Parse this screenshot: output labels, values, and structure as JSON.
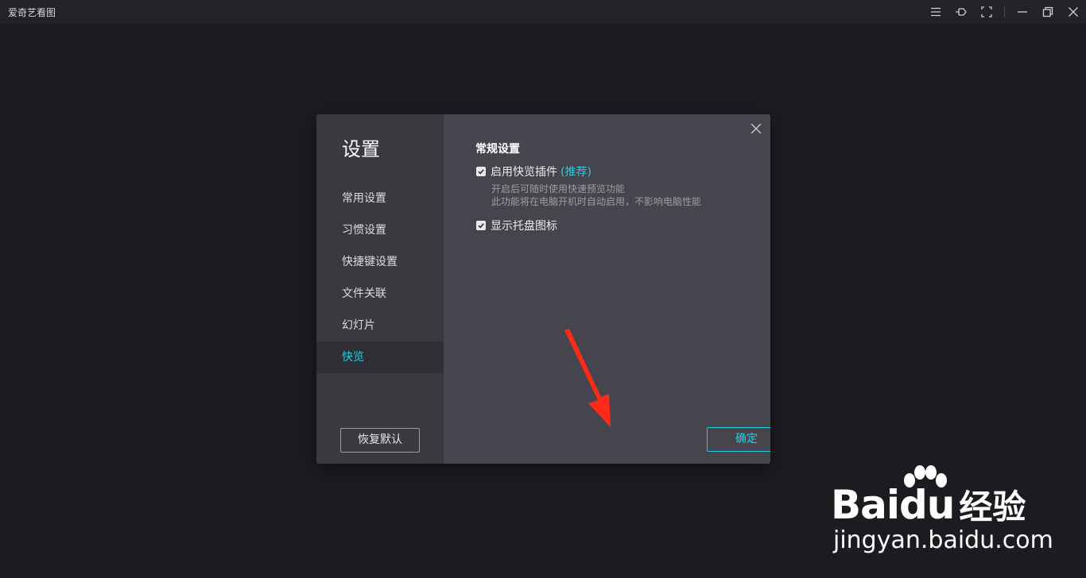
{
  "window": {
    "title": "爱奇艺看图",
    "icons": [
      "menu-icon",
      "pin-icon",
      "fullscreen-icon",
      "minimize-icon",
      "restore-icon",
      "close-icon"
    ]
  },
  "dialog": {
    "title": "设置",
    "nav": [
      {
        "label": "常用设置",
        "active": false
      },
      {
        "label": "习惯设置",
        "active": false
      },
      {
        "label": "快捷键设置",
        "active": false
      },
      {
        "label": "文件关联",
        "active": false
      },
      {
        "label": "幻灯片",
        "active": false
      },
      {
        "label": "快览",
        "active": true
      }
    ],
    "reset_label": "恢复默认",
    "section_title": "常规设置",
    "option1": {
      "label": "启用快览插件",
      "recommend": "(推荐)",
      "checked": true,
      "desc1": "开启后可随时使用快速预览功能",
      "desc2": "此功能将在电脑开机时自动启用，不影响电脑性能"
    },
    "option2": {
      "label": "显示托盘图标",
      "checked": true
    },
    "ok_label": "确定",
    "close_label": "关闭"
  },
  "colors": {
    "accent": "#1fd0e6",
    "annotation_arrow": "#ff2a1a",
    "background": "#1c1b20"
  },
  "watermark": {
    "brand": "Baidu",
    "brand_cn": "经验",
    "url": "jingyan.baidu.com"
  }
}
